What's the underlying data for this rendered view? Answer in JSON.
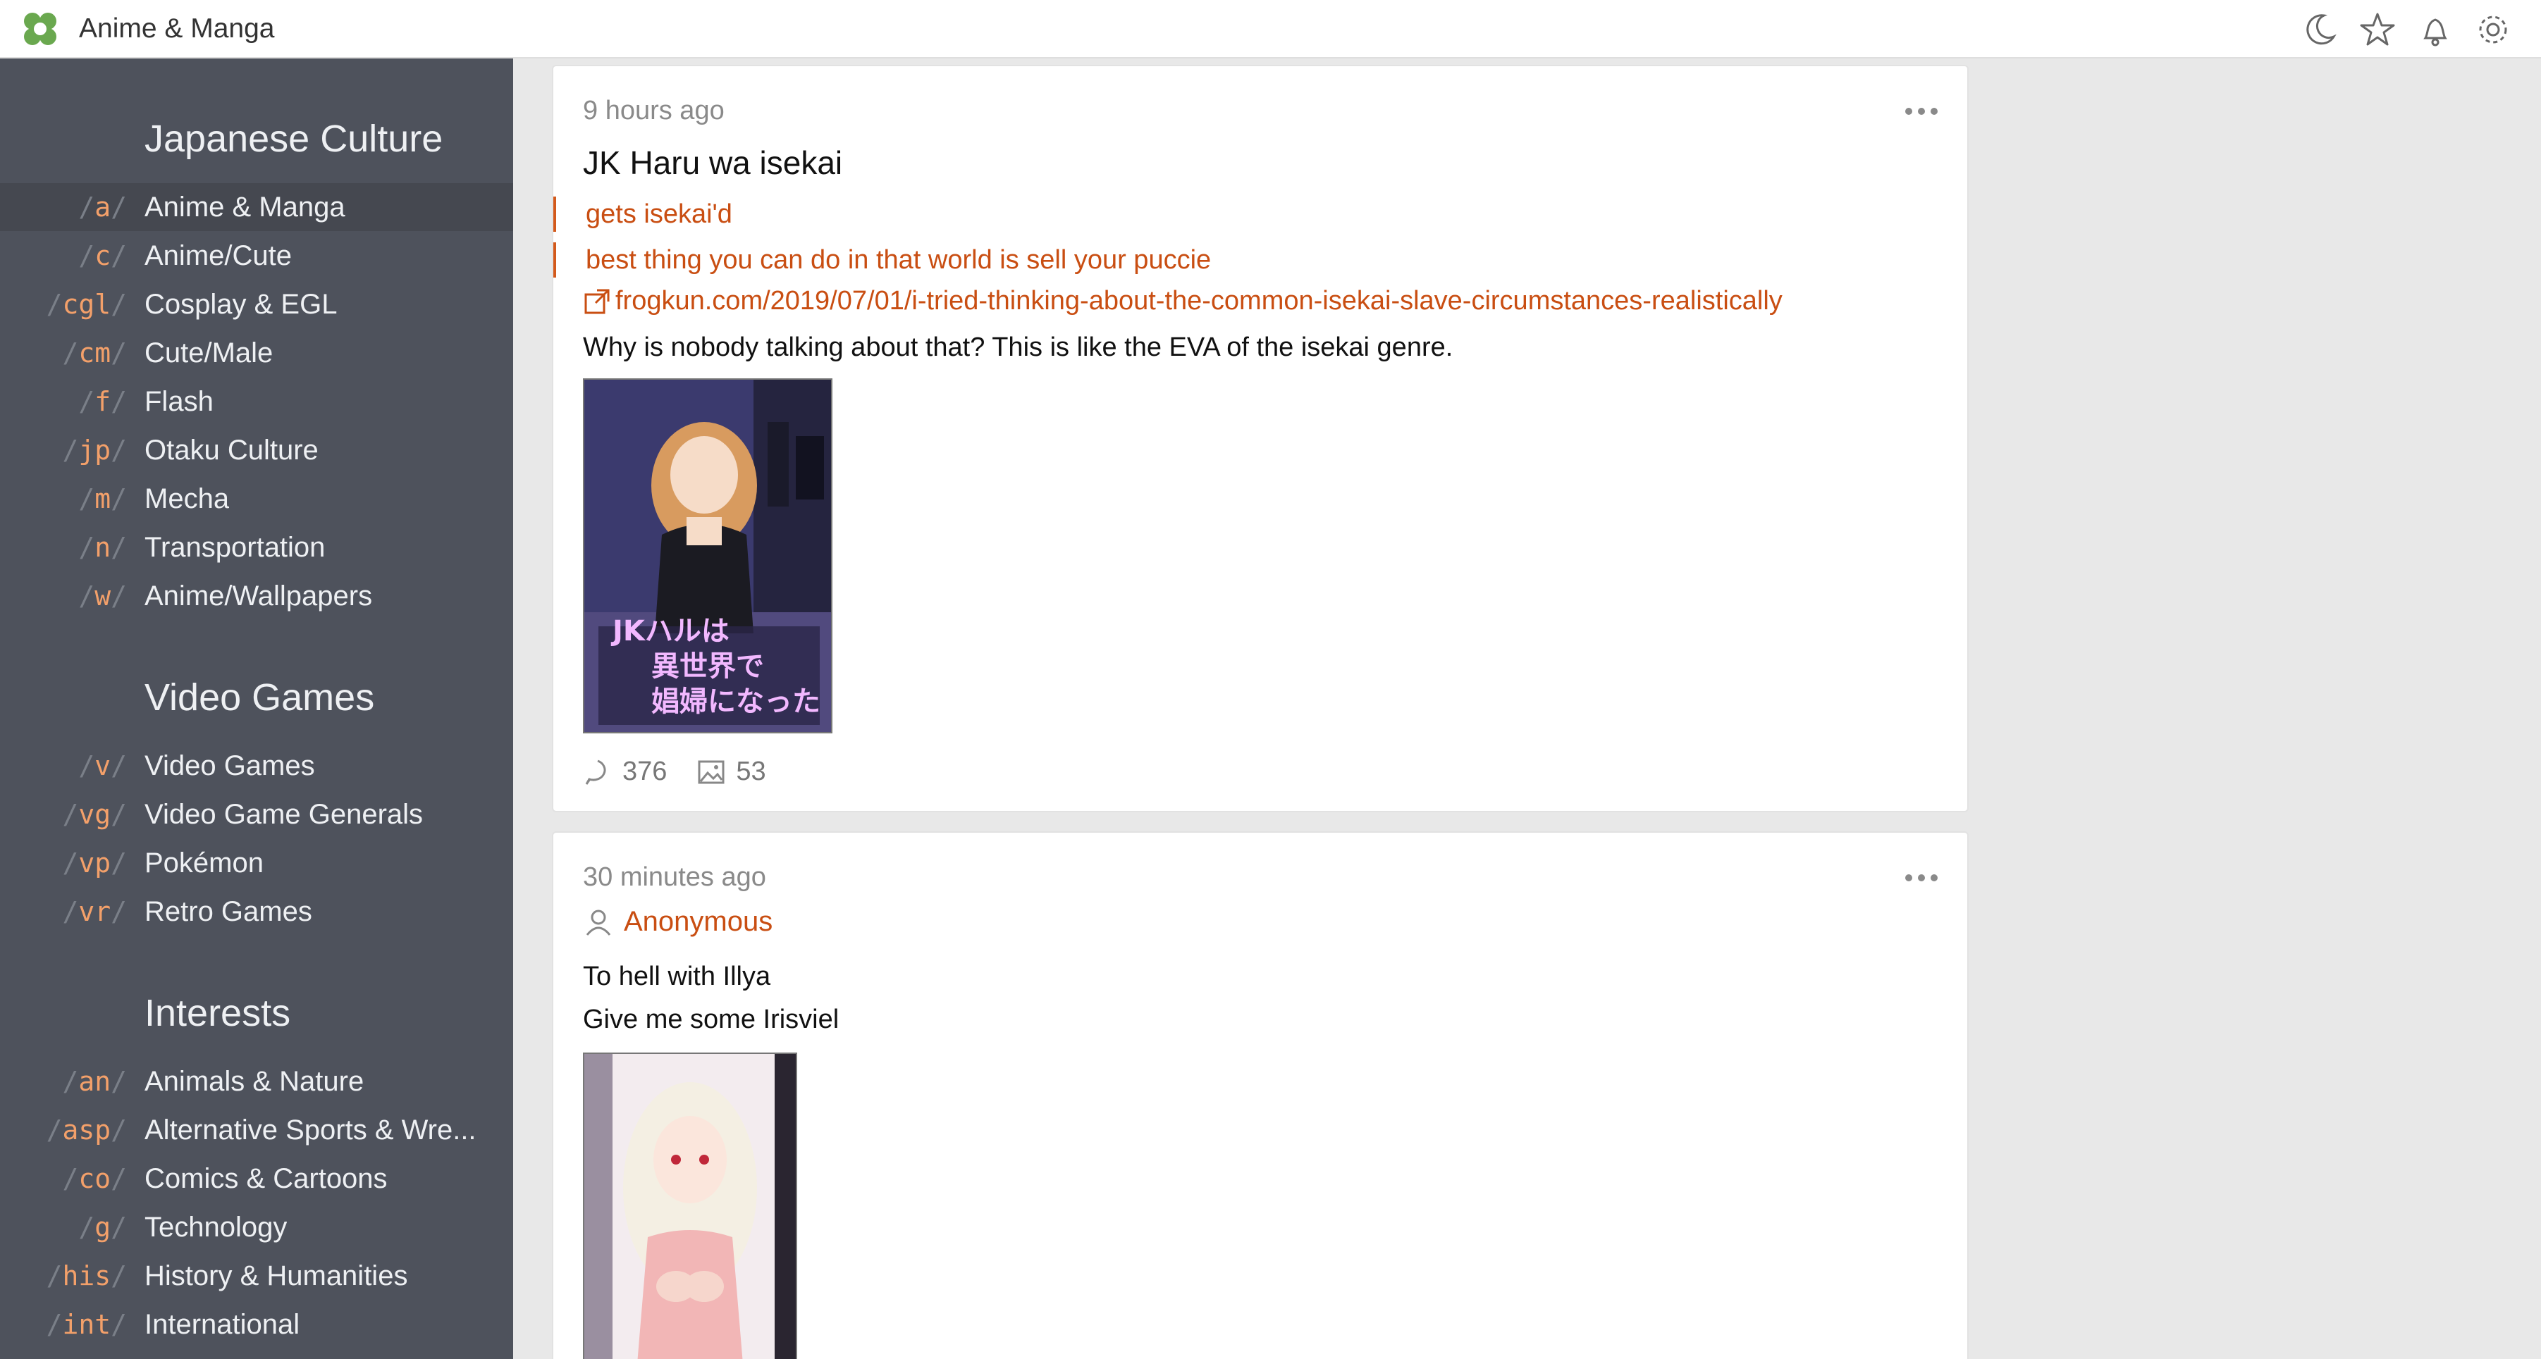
{
  "app": {
    "title": "Anime & Manga"
  },
  "top_icons": [
    "moon-icon",
    "star-icon",
    "bell-icon",
    "gear-icon"
  ],
  "sidebar": {
    "sections": [
      {
        "heading": "Japanese Culture",
        "items": [
          {
            "code": "a",
            "label": "Anime & Manga",
            "active": true
          },
          {
            "code": "c",
            "label": "Anime/Cute"
          },
          {
            "code": "cgl",
            "label": "Cosplay & EGL"
          },
          {
            "code": "cm",
            "label": "Cute/Male"
          },
          {
            "code": "f",
            "label": "Flash"
          },
          {
            "code": "jp",
            "label": "Otaku Culture"
          },
          {
            "code": "m",
            "label": "Mecha"
          },
          {
            "code": "n",
            "label": "Transportation"
          },
          {
            "code": "w",
            "label": "Anime/Wallpapers"
          }
        ]
      },
      {
        "heading": "Video Games",
        "items": [
          {
            "code": "v",
            "label": "Video Games"
          },
          {
            "code": "vg",
            "label": "Video Game Generals"
          },
          {
            "code": "vp",
            "label": "Pokémon"
          },
          {
            "code": "vr",
            "label": "Retro Games"
          }
        ]
      },
      {
        "heading": "Interests",
        "items": [
          {
            "code": "an",
            "label": "Animals & Nature"
          },
          {
            "code": "asp",
            "label": "Alternative Sports & Wre..."
          },
          {
            "code": "co",
            "label": "Comics & Cartoons"
          },
          {
            "code": "g",
            "label": "Technology"
          },
          {
            "code": "his",
            "label": "History & Humanities"
          },
          {
            "code": "int",
            "label": "International"
          }
        ]
      }
    ]
  },
  "threads": [
    {
      "time": "9 hours ago",
      "title": "JK Haru wa isekai",
      "greentext": [
        "gets isekai'd",
        "best thing you can do in that world is sell your puccie"
      ],
      "link": "frogkun.com/2019/07/01/i-tried-thinking-about-the-common-isekai-slave-circumstances-realistically",
      "text": "Why is nobody talking about that? This is like the EVA of the isekai genre.",
      "replies": "376",
      "images": "53"
    },
    {
      "time": "30 minutes ago",
      "author": "Anonymous",
      "lines": [
        "To hell with Illya",
        "Give me some Irisviel"
      ]
    }
  ]
}
